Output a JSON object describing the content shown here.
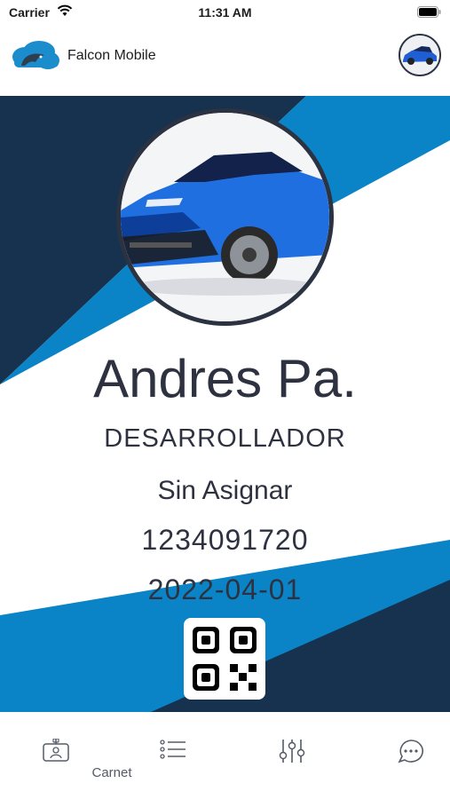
{
  "status_bar": {
    "carrier": "Carrier",
    "time": "11:31 AM"
  },
  "header": {
    "app_title": "Falcon Mobile",
    "logo": "falcon-cloud-logo",
    "avatar": "car-photo"
  },
  "card": {
    "name": "Andres Pa.",
    "role": "DESARROLLADOR",
    "department": "Sin Asignar",
    "id_number": "1234091720",
    "date": "2022-04-01",
    "photo": "blue-sports-car",
    "qr": "qr-code-icon",
    "colors": {
      "navy": "#17324f",
      "blue": "#0a84c6",
      "frame": "#2b3241",
      "text": "#2e3240"
    }
  },
  "tabs": [
    {
      "label": "Carnet",
      "icon": "id-badge-icon"
    },
    {
      "label": "",
      "icon": "list-icon"
    },
    {
      "label": "",
      "icon": "sliders-icon"
    },
    {
      "label": "",
      "icon": "chat-icon"
    }
  ]
}
